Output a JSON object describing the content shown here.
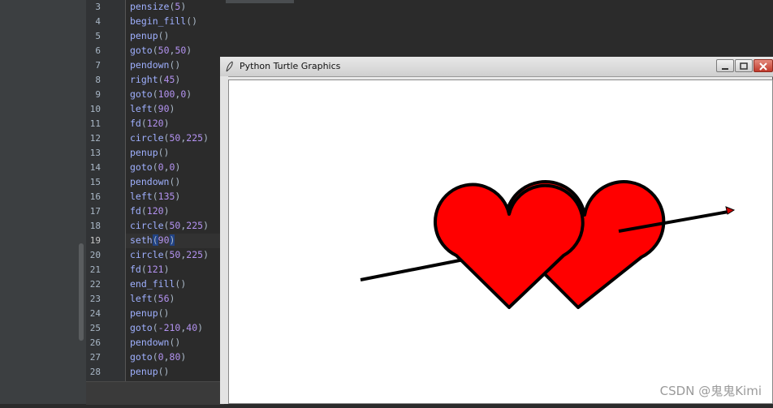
{
  "editor": {
    "lines": [
      {
        "num": "3",
        "tokens": [
          [
            "fn",
            "pensize"
          ],
          [
            "p",
            "("
          ],
          [
            "num",
            "5"
          ],
          [
            "p",
            ")"
          ]
        ]
      },
      {
        "num": "4",
        "tokens": [
          [
            "fn",
            "begin_fill"
          ],
          [
            "p",
            "()"
          ]
        ]
      },
      {
        "num": "5",
        "tokens": [
          [
            "fn",
            "penup"
          ],
          [
            "p",
            "()"
          ]
        ]
      },
      {
        "num": "6",
        "tokens": [
          [
            "fn",
            "goto"
          ],
          [
            "p",
            "("
          ],
          [
            "num",
            "50"
          ],
          [
            "p",
            ","
          ],
          [
            "num",
            "50"
          ],
          [
            "p",
            ")"
          ]
        ]
      },
      {
        "num": "7",
        "tokens": [
          [
            "fn",
            "pendown"
          ],
          [
            "p",
            "()"
          ]
        ]
      },
      {
        "num": "8",
        "tokens": [
          [
            "fn",
            "right"
          ],
          [
            "p",
            "("
          ],
          [
            "num",
            "45"
          ],
          [
            "p",
            ")"
          ]
        ]
      },
      {
        "num": "9",
        "tokens": [
          [
            "fn",
            "goto"
          ],
          [
            "p",
            "("
          ],
          [
            "num",
            "100"
          ],
          [
            "p",
            ","
          ],
          [
            "num",
            "0"
          ],
          [
            "p",
            ")"
          ]
        ]
      },
      {
        "num": "10",
        "tokens": [
          [
            "fn",
            "left"
          ],
          [
            "p",
            "("
          ],
          [
            "num",
            "90"
          ],
          [
            "p",
            ")"
          ]
        ]
      },
      {
        "num": "11",
        "tokens": [
          [
            "fn",
            "fd"
          ],
          [
            "p",
            "("
          ],
          [
            "num",
            "120"
          ],
          [
            "p",
            ")"
          ]
        ]
      },
      {
        "num": "12",
        "tokens": [
          [
            "fn",
            "circle"
          ],
          [
            "p",
            "("
          ],
          [
            "num",
            "50"
          ],
          [
            "p",
            ","
          ],
          [
            "num",
            "225"
          ],
          [
            "p",
            ")"
          ]
        ]
      },
      {
        "num": "13",
        "tokens": [
          [
            "fn",
            "penup"
          ],
          [
            "p",
            "()"
          ]
        ]
      },
      {
        "num": "14",
        "tokens": [
          [
            "fn",
            "goto"
          ],
          [
            "p",
            "("
          ],
          [
            "num",
            "0"
          ],
          [
            "p",
            ","
          ],
          [
            "num",
            "0"
          ],
          [
            "p",
            ")"
          ]
        ]
      },
      {
        "num": "15",
        "tokens": [
          [
            "fn",
            "pendown"
          ],
          [
            "p",
            "()"
          ]
        ]
      },
      {
        "num": "16",
        "tokens": [
          [
            "fn",
            "left"
          ],
          [
            "p",
            "("
          ],
          [
            "num",
            "135"
          ],
          [
            "p",
            ")"
          ]
        ]
      },
      {
        "num": "17",
        "tokens": [
          [
            "fn",
            "fd"
          ],
          [
            "p",
            "("
          ],
          [
            "num",
            "120"
          ],
          [
            "p",
            ")"
          ]
        ]
      },
      {
        "num": "18",
        "tokens": [
          [
            "fn",
            "circle"
          ],
          [
            "p",
            "("
          ],
          [
            "num",
            "50"
          ],
          [
            "p",
            ","
          ],
          [
            "num",
            "225"
          ],
          [
            "p",
            ")"
          ]
        ]
      },
      {
        "num": "19",
        "current": true,
        "tokens": [
          [
            "fn",
            "seth"
          ],
          [
            "sel",
            "("
          ],
          [
            "num",
            "90"
          ],
          [
            "sel",
            ")"
          ]
        ]
      },
      {
        "num": "20",
        "tokens": [
          [
            "fn",
            "circle"
          ],
          [
            "p",
            "("
          ],
          [
            "num",
            "50"
          ],
          [
            "p",
            ","
          ],
          [
            "num",
            "225"
          ],
          [
            "p",
            ")"
          ]
        ]
      },
      {
        "num": "21",
        "tokens": [
          [
            "fn",
            "fd"
          ],
          [
            "p",
            "("
          ],
          [
            "num",
            "121"
          ],
          [
            "p",
            ")"
          ]
        ]
      },
      {
        "num": "22",
        "tokens": [
          [
            "fn",
            "end_fill"
          ],
          [
            "p",
            "()"
          ]
        ]
      },
      {
        "num": "23",
        "tokens": [
          [
            "fn",
            "left"
          ],
          [
            "p",
            "("
          ],
          [
            "num",
            "56"
          ],
          [
            "p",
            ")"
          ]
        ]
      },
      {
        "num": "24",
        "tokens": [
          [
            "fn",
            "penup"
          ],
          [
            "p",
            "()"
          ]
        ]
      },
      {
        "num": "25",
        "tokens": [
          [
            "fn",
            "goto"
          ],
          [
            "p",
            "("
          ],
          [
            "num",
            "-210"
          ],
          [
            "p",
            ","
          ],
          [
            "num",
            "40"
          ],
          [
            "p",
            ")"
          ]
        ]
      },
      {
        "num": "26",
        "tokens": [
          [
            "fn",
            "pendown"
          ],
          [
            "p",
            "()"
          ]
        ]
      },
      {
        "num": "27",
        "tokens": [
          [
            "fn",
            "goto"
          ],
          [
            "p",
            "("
          ],
          [
            "num",
            "0"
          ],
          [
            "p",
            ","
          ],
          [
            "num",
            "80"
          ],
          [
            "p",
            ")"
          ]
        ]
      },
      {
        "num": "28",
        "tokens": [
          [
            "fn",
            "penup"
          ],
          [
            "p",
            "()"
          ]
        ]
      }
    ]
  },
  "turtle_window": {
    "title": "Python Turtle Graphics",
    "fill_color": "#ff0000",
    "pen_color": "#000000",
    "buttons": {
      "minimize": "minimize",
      "maximize": "maximize",
      "close": "close"
    }
  },
  "watermark": "CSDN @鬼鬼Kimi"
}
